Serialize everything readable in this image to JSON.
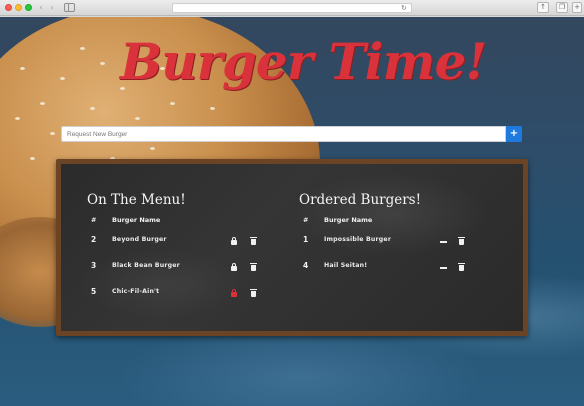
{
  "header": {
    "title": "Burger Time!"
  },
  "request": {
    "placeholder": "Request New Burger",
    "add_label": "+"
  },
  "menu": {
    "heading": "On The Menu!",
    "col_num": "#",
    "col_name": "Burger Name",
    "rows": [
      {
        "id": "2",
        "name": "Beyond Burger",
        "highlight": false
      },
      {
        "id": "3",
        "name": "Black Bean Burger",
        "highlight": false
      },
      {
        "id": "5",
        "name": "Chic-Fil-Ain't",
        "highlight": true
      }
    ]
  },
  "ordered": {
    "heading": "Ordered Burgers!",
    "col_num": "#",
    "col_name": "Burger Name",
    "rows": [
      {
        "id": "1",
        "name": "Impossible Burger"
      },
      {
        "id": "4",
        "name": "Hail Seitan!"
      }
    ]
  },
  "colors": {
    "accent_red": "#d9323a",
    "button_blue": "#1f7ae0",
    "chalkboard": "#2f2f2f",
    "frame": "#6b4426"
  }
}
